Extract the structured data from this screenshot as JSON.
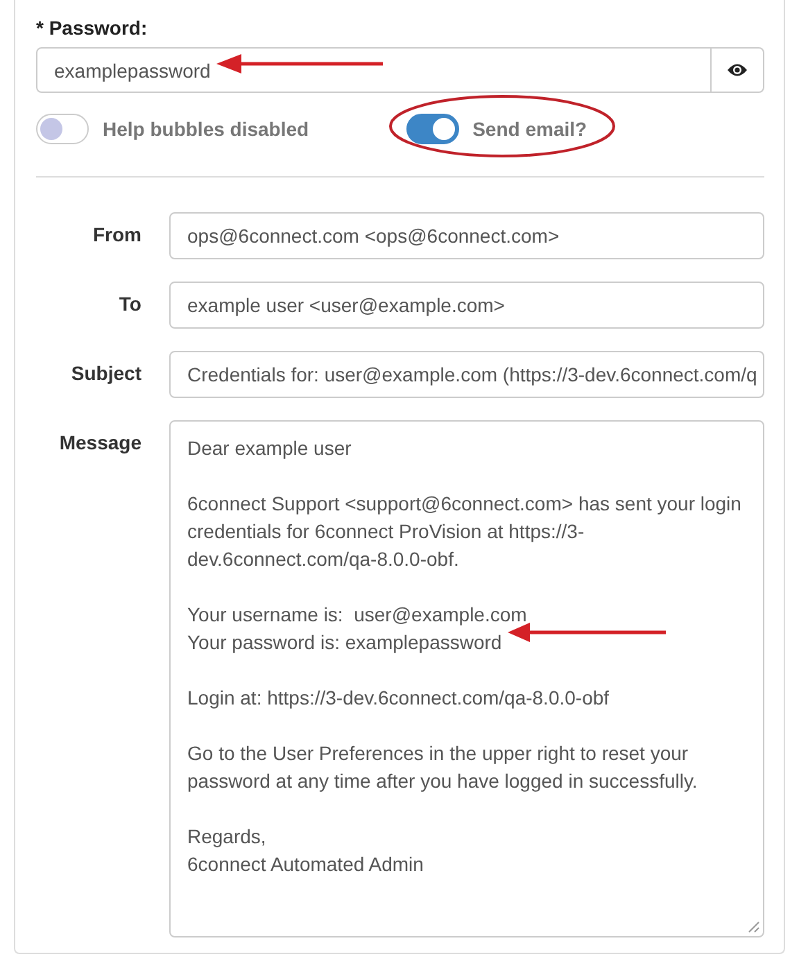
{
  "password": {
    "required_mark": "*",
    "label": "Password:",
    "value": "examplepassword"
  },
  "toggles": [
    {
      "label": "Help bubbles disabled",
      "on": false
    },
    {
      "label": "Send email?",
      "on": true
    }
  ],
  "email": {
    "fields": [
      {
        "label": "From",
        "value": "ops@6connect.com <ops@6connect.com>"
      },
      {
        "label": "To",
        "value": "example user <user@example.com>"
      },
      {
        "label": "Subject",
        "value": "Credentials for: user@example.com (https://3-dev.6connect.com/q"
      }
    ],
    "message": {
      "label": "Message",
      "paragraphs": [
        [
          "Dear example user"
        ],
        [
          "6connect Support <support@6connect.com> has sent your login",
          "credentials for 6connect ProVision at https://3-",
          "dev.6connect.com/qa-8.0.0-obf."
        ],
        [
          "Your username is:  user@example.com",
          "Your password is: examplepassword"
        ],
        [
          "Login at: https://3-dev.6connect.com/qa-8.0.0-obf"
        ],
        [
          "Go to the User Preferences in the upper right to reset your",
          "password at any time after you have logged in successfully."
        ],
        [
          "Regards,",
          "6connect Automated Admin"
        ]
      ]
    }
  }
}
